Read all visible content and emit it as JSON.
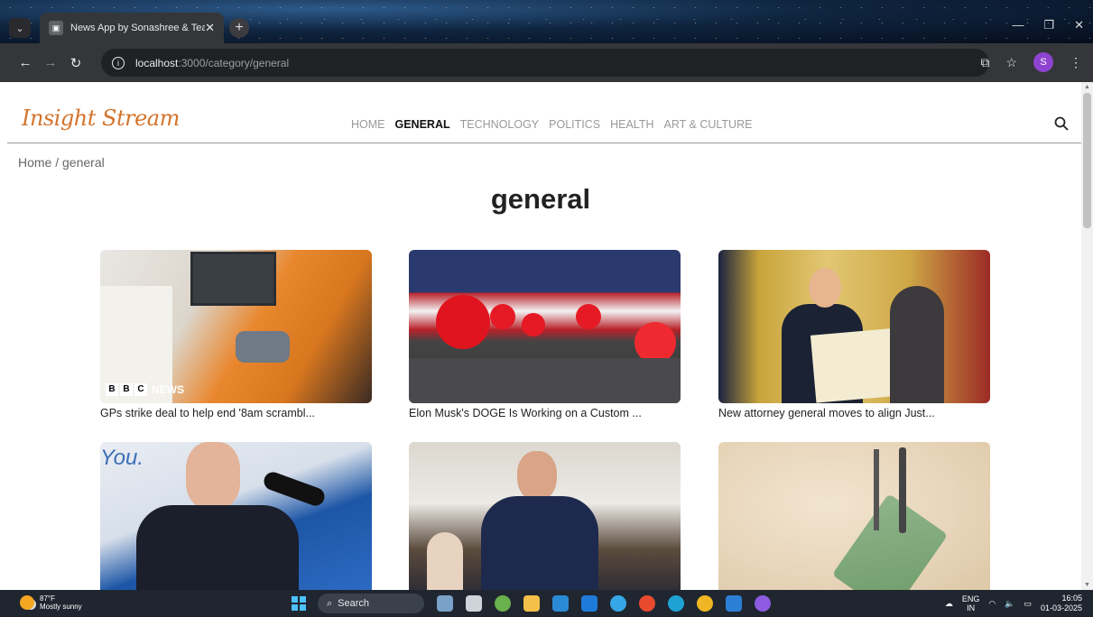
{
  "browser": {
    "tab_title": "News App by Sonashree & Team",
    "url_host": "localhost",
    "url_path": ":3000/category/general",
    "profile_initial": "S"
  },
  "site": {
    "logo": "Insight Stream",
    "nav": [
      "HOME",
      "GENERAL",
      "TECHNOLOGY",
      "POLITICS",
      "HEALTH",
      "ART & CULTURE"
    ],
    "active_nav": "GENERAL",
    "breadcrumb": "Home / general",
    "page_title": "general"
  },
  "articles": [
    {
      "title": "GPs strike deal to help end '8am scrambl...",
      "badge": "NEWS"
    },
    {
      "title": "Elon Musk's DOGE Is Working on a Custom ..."
    },
    {
      "title": "New attorney general moves to align Just..."
    },
    {
      "title": ""
    },
    {
      "title": ""
    },
    {
      "title": ""
    }
  ],
  "taskbar": {
    "weather_temp": "87°F",
    "weather_desc": "Mostly sunny",
    "search_label": "Search",
    "lang": "ENG",
    "region": "IN",
    "time": "16:05",
    "date": "01-03-2025"
  }
}
